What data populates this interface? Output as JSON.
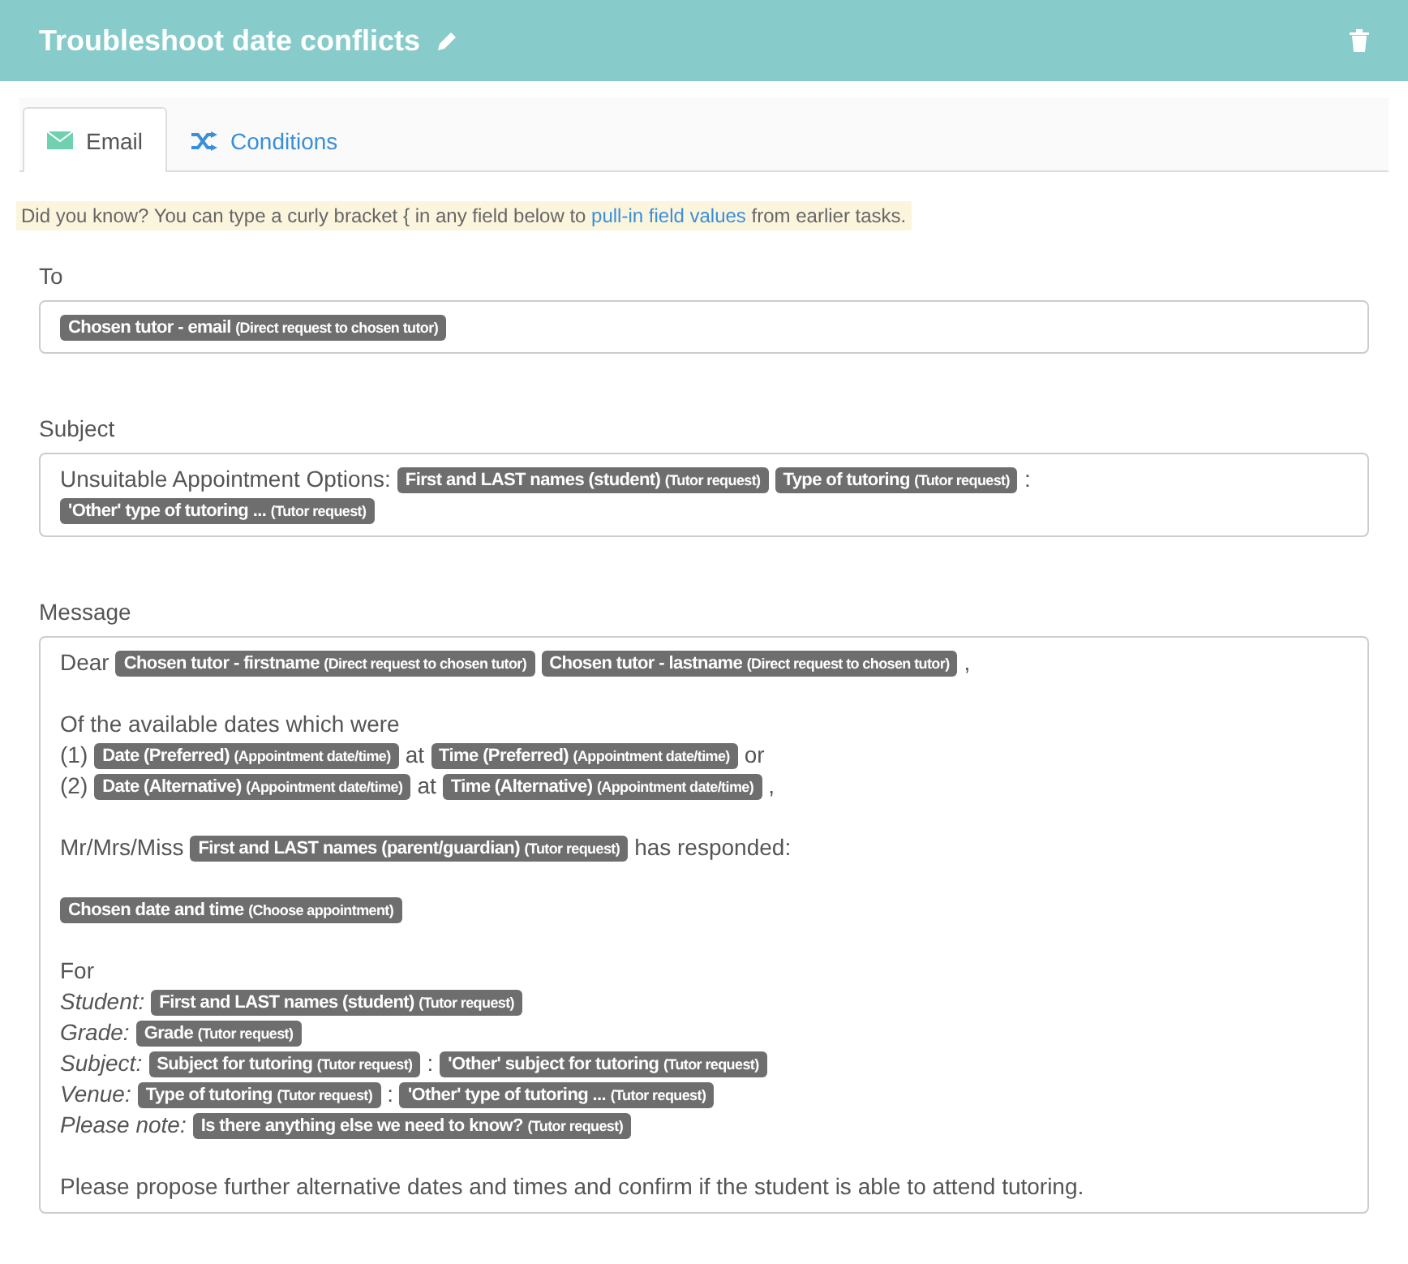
{
  "header": {
    "title": "Troubleshoot date conflicts"
  },
  "tabs": [
    {
      "label": "Email",
      "selected": true
    },
    {
      "label": "Conditions",
      "selected": false
    }
  ],
  "tip": {
    "before": "Did you know? You can type a curly bracket { in any field below to ",
    "link": "pull-in field values",
    "after": " from earlier tasks."
  },
  "fields": [
    {
      "label": "To",
      "paragraphs": [
        {
          "lines": [
            {
              "segments": [
                {
                  "kind": "token",
                  "name": "Chosen tutor - email",
                  "source": "(Direct request to chosen tutor)"
                }
              ]
            }
          ]
        }
      ]
    },
    {
      "label": "Subject",
      "paragraphs": [
        {
          "lines": [
            {
              "segments": [
                {
                  "kind": "text",
                  "text": "Unsuitable Appointment Options:"
                },
                {
                  "kind": "token",
                  "name": "First and LAST names (student)",
                  "source": "(Tutor request)"
                },
                {
                  "kind": "token",
                  "name": "Type of tutoring",
                  "source": "(Tutor request)"
                },
                {
                  "kind": "text",
                  "text": ":"
                }
              ]
            },
            {
              "segments": [
                {
                  "kind": "token",
                  "name": "'Other' type of tutoring ...",
                  "source": "(Tutor request)"
                }
              ]
            }
          ]
        }
      ]
    },
    {
      "label": "Message",
      "paragraphs": [
        {
          "lines": [
            {
              "segments": [
                {
                  "kind": "text",
                  "text": "Dear"
                },
                {
                  "kind": "token",
                  "name": "Chosen tutor - firstname",
                  "source": "(Direct request to chosen tutor)"
                },
                {
                  "kind": "token",
                  "name": "Chosen tutor - lastname",
                  "source": "(Direct request to chosen tutor)"
                },
                {
                  "kind": "text",
                  "text": ","
                }
              ]
            }
          ]
        },
        {
          "lines": [
            {
              "segments": [
                {
                  "kind": "text",
                  "text": "Of the available dates which were"
                }
              ]
            },
            {
              "segments": [
                {
                  "kind": "text",
                  "text": "(1)"
                },
                {
                  "kind": "token",
                  "name": "Date (Preferred)",
                  "source": "(Appointment date/time)"
                },
                {
                  "kind": "text",
                  "text": "at"
                },
                {
                  "kind": "token",
                  "name": "Time (Preferred)",
                  "source": "(Appointment date/time)"
                },
                {
                  "kind": "text",
                  "text": "or"
                }
              ]
            },
            {
              "segments": [
                {
                  "kind": "text",
                  "text": "(2)"
                },
                {
                  "kind": "token",
                  "name": "Date (Alternative)",
                  "source": "(Appointment date/time)"
                },
                {
                  "kind": "text",
                  "text": "at"
                },
                {
                  "kind": "token",
                  "name": "Time (Alternative)",
                  "source": "(Appointment date/time)"
                },
                {
                  "kind": "text",
                  "text": ","
                }
              ]
            }
          ]
        },
        {
          "lines": [
            {
              "segments": [
                {
                  "kind": "text",
                  "text": "Mr/Mrs/Miss"
                },
                {
                  "kind": "token",
                  "name": "First and LAST names (parent/guardian)",
                  "source": "(Tutor request)"
                },
                {
                  "kind": "text",
                  "text": "has responded:"
                }
              ]
            }
          ]
        },
        {
          "lines": [
            {
              "segments": [
                {
                  "kind": "token",
                  "name": "Chosen date and time",
                  "source": "(Choose appointment)"
                }
              ]
            }
          ]
        },
        {
          "lines": [
            {
              "segments": [
                {
                  "kind": "text",
                  "text": "For"
                }
              ]
            },
            {
              "segments": [
                {
                  "kind": "label",
                  "text": "Student:"
                },
                {
                  "kind": "token",
                  "name": "First and LAST names (student)",
                  "source": "(Tutor request)"
                }
              ]
            },
            {
              "segments": [
                {
                  "kind": "label",
                  "text": "Grade:"
                },
                {
                  "kind": "token",
                  "name": "Grade",
                  "source": "(Tutor request)"
                }
              ]
            },
            {
              "segments": [
                {
                  "kind": "label",
                  "text": "Subject:"
                },
                {
                  "kind": "token",
                  "name": "Subject for tutoring",
                  "source": "(Tutor request)"
                },
                {
                  "kind": "text",
                  "text": ":"
                },
                {
                  "kind": "token",
                  "name": "'Other' subject for tutoring",
                  "source": "(Tutor request)"
                }
              ]
            },
            {
              "segments": [
                {
                  "kind": "label",
                  "text": "Venue:"
                },
                {
                  "kind": "token",
                  "name": "Type of tutoring",
                  "source": "(Tutor request)"
                },
                {
                  "kind": "text",
                  "text": ":"
                },
                {
                  "kind": "token",
                  "name": "'Other' type of tutoring ...",
                  "source": "(Tutor request)"
                }
              ]
            },
            {
              "segments": [
                {
                  "kind": "label",
                  "text": "Please note:"
                },
                {
                  "kind": "token",
                  "name": "Is there anything else we need to know?",
                  "source": "(Tutor request)"
                }
              ]
            }
          ]
        },
        {
          "lines": [
            {
              "segments": [
                {
                  "kind": "text",
                  "text": "Please propose further alternative dates and times and confirm if the student is able to attend tutoring."
                }
              ]
            }
          ]
        }
      ]
    }
  ]
}
